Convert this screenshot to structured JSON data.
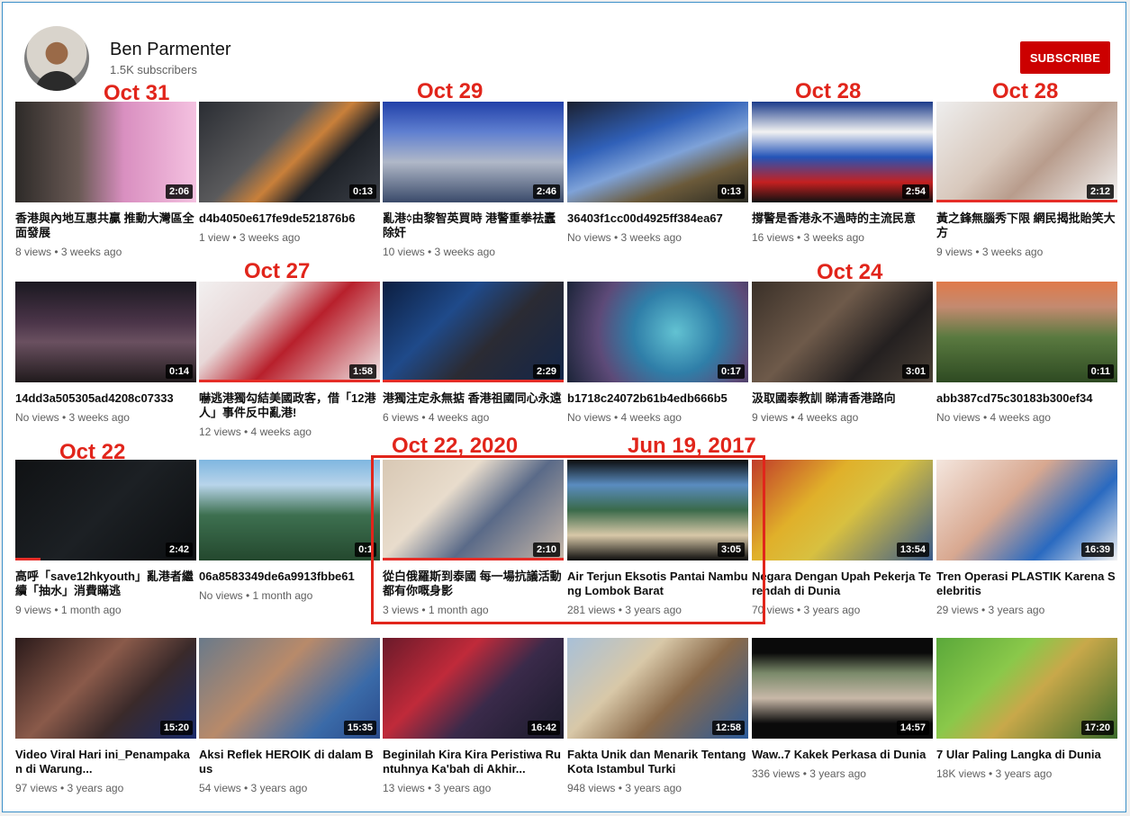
{
  "channel": {
    "name": "Ben Parmenter",
    "subscribers": "1.5K subscribers",
    "subscribe_label": "SUBSCRIBE"
  },
  "annotations": [
    "Oct 31",
    "Oct 29",
    "Oct 28",
    "Oct 28",
    "Oct 27",
    "Oct 24",
    "Oct 22",
    "Oct 22, 2020",
    "Jun 19, 2017"
  ],
  "videos": [
    {
      "title": "香港與內地互惠共贏 推動大灣區全面發展",
      "meta": "8 views • 3 weeks ago",
      "duration": "2:06",
      "art": "linear-gradient(90deg,#2d2a28 0%,#6a5a55 35%,#d98fc0 60%,#f4c1e0 100%)",
      "progress": 0
    },
    {
      "title": "d4b4050e617fe9de521876b6",
      "meta": "1 view • 3 weeks ago",
      "duration": "0:13",
      "art": "linear-gradient(135deg,#2a2d33 0%,#5a5a5c 40%,#c9803a 55%,#1e2228 70%,#3c4048 100%)",
      "progress": 0
    },
    {
      "title": "亂港᨟由黎智英買時 港警重拳祛蠹除奸",
      "meta": "10 views • 3 weeks ago",
      "duration": "2:46",
      "art": "linear-gradient(180deg,#2140a8 0%,#5f7fd0 30%,#b0b8c8 60%,#3a4a6a 100%)",
      "progress": 0
    },
    {
      "title": "36403f1cc00d4925ff384ea67",
      "meta": "No views • 3 weeks ago",
      "duration": "0:13",
      "art": "linear-gradient(160deg,#1b2030 0%,#3060b8 35%,#7ea2d8 55%,#6b5a3a 75%,#2a2a22 100%)",
      "progress": 0
    },
    {
      "title": "撐警是香港永不過時的主流民意",
      "meta": "16 views • 3 weeks ago",
      "duration": "2:54",
      "art": "linear-gradient(180deg,#1a3a8a 0%,#f2f2f2 30%,#2454b8 55%,#c42020 80%,#111 100%)",
      "progress": 0
    },
    {
      "title": "黃之鋒無腦秀下限 網民揭批貽笑大方",
      "meta": "9 views • 3 weeks ago",
      "duration": "2:12",
      "art": "linear-gradient(135deg,#eeeeee 0%,#d8c8bc 40%,#b89c8c 60%,#f3f3f3 100%)",
      "progress": 100
    },
    {
      "title": "14dd3a505305ad4208c07333",
      "meta": "No views • 3 weeks ago",
      "duration": "0:14",
      "art": "linear-gradient(180deg,#1a1820 0%,#4a3448 40%,#6a5060 60%,#201a1c 100%)",
      "progress": 0
    },
    {
      "title": "嚇逃港獨勾結美國政客，借「12港人」事件反中亂港!",
      "meta": "12 views • 4 weeks ago",
      "duration": "1:58",
      "art": "linear-gradient(135deg,#f2f0f0 0%,#e8d8d8 30%,#b8202c 55%,#f0eaea 100%)",
      "progress": 100
    },
    {
      "title": "港獨注定永無掂 香港祖國同心永遠",
      "meta": "6 views • 4 weeks ago",
      "duration": "2:29",
      "art": "linear-gradient(135deg,#0c1e40 0%,#1f4a8a 35%,#2b2b33 60%,#13264a 100%)",
      "progress": 100
    },
    {
      "title": "b1718c24072b61b4edb666b5",
      "meta": "No views • 4 weeks ago",
      "duration": "0:17",
      "art": "radial-gradient(circle at 60% 50%,#62c2d2 0%,#2f7ea8 35%,#5d4a78 65%,#1b2438 100%)",
      "progress": 0
    },
    {
      "title": "汲取國泰教訓 睇清香港路向",
      "meta": "9 views • 4 weeks ago",
      "duration": "3:01",
      "art": "linear-gradient(135deg,#3a3028 0%,#6e5a4a 40%,#242020 70%,#4a4036 100%)",
      "progress": 0
    },
    {
      "title": "abb387cd75c30183b300ef34",
      "meta": "No views • 4 weeks ago",
      "duration": "0:11",
      "art": "linear-gradient(180deg,#e07a4a 0%,#c48a70 25%,#5a7a40 55%,#2e4a22 100%)",
      "progress": 0
    },
    {
      "title": "高呼「save12hkyouth」亂港者繼續「抽水」消費瞞逃",
      "meta": "9 views • 1 month ago",
      "duration": "2:42",
      "art": "linear-gradient(135deg,#101214 0%,#1c2024 50%,#0c0e10 100%)",
      "progress": 14
    },
    {
      "title": "06a8583349de6a9913fbbe61",
      "meta": "No views • 1 month ago",
      "duration": "0:1",
      "art": "linear-gradient(180deg,#7fb6e0 0%,#b8d4ea 25%,#3d7050 55%,#24482e 100%)",
      "progress": 0
    },
    {
      "title": "從白俄羅斯到泰國 每一場抗議活動都有你嘅身影",
      "meta": "3 views • 1 month ago",
      "duration": "2:10",
      "art": "linear-gradient(135deg,#d8c8b4 0%,#e8dccc 35%,#5a6a88 60%,#c8b8a8 100%)",
      "progress": 100
    },
    {
      "title": "Air Terjun Eksotis Pantai Nambung Lombok Barat",
      "meta": "281 views • 3 years ago",
      "duration": "3:05",
      "art": "linear-gradient(180deg,#0c0c0c 0%,#5a8cc0 25%,#3a6a4a 50%,#d8c8a8 75%,#0c0c0c 100%)",
      "progress": 0
    },
    {
      "title": "Negara Dengan Upah Pekerja Terendah di Dunia",
      "meta": "70 views • 3 years ago",
      "duration": "13:54",
      "art": "linear-gradient(135deg,#c03a2a 0%,#e0b02a 35%,#d8c040 55%,#3a5a8a 100%)",
      "progress": 0
    },
    {
      "title": "Tren Operasi PLASTIK Karena Selebritis",
      "meta": "29 views • 3 years ago",
      "duration": "16:39",
      "art": "linear-gradient(135deg,#f4e6de 0%,#d8a890 40%,#2a6ac0 70%,#f2f2f2 100%)",
      "progress": 0
    },
    {
      "title": "Video Viral Hari ini_Penampakan di Warung...",
      "meta": "97 views • 3 years ago",
      "duration": "15:20",
      "art": "linear-gradient(135deg,#2a1a1a 0%,#8a5a4a 40%,#3a2a2a 65%,#1a2a6a 100%)",
      "progress": 0
    },
    {
      "title": "Aksi Reflek HEROIK di dalam Bus",
      "meta": "54 views • 3 years ago",
      "duration": "15:35",
      "art": "linear-gradient(135deg,#6a7a8a 0%,#b88a6a 40%,#3a6aa8 75%,#2a4a8a 100%)",
      "progress": 0
    },
    {
      "title": "Beginilah Kira Kira Peristiwa Runtuhnya Ka'bah di Akhir...",
      "meta": "13 views • 3 years ago",
      "duration": "16:42",
      "art": "linear-gradient(135deg,#6a1a2a 0%,#c02a3a 35%,#3a2a4a 60%,#1a1a2a 100%)",
      "progress": 0
    },
    {
      "title": "Fakta Unik dan Menarik Tentang Kota Istambul Turki",
      "meta": "948 views • 3 years ago",
      "duration": "12:58",
      "art": "linear-gradient(135deg,#a8c0d8 0%,#d8c8a8 35%,#8a6a4a 60%,#2a5a9a 100%)",
      "progress": 0
    },
    {
      "title": "Waw..7 Kakek Perkasa di Dunia",
      "meta": "336 views • 3 years ago",
      "duration": "14:57",
      "art": "linear-gradient(180deg,#0a0a0a 0%,#0a0a0a 15%,#7a8a6a 35%,#c8b8a8 60%,#0a0a0a 85%)",
      "progress": 0
    },
    {
      "title": "7 Ular Paling Langka di Dunia",
      "meta": "18K views • 3 years ago",
      "duration": "17:20",
      "art": "linear-gradient(135deg,#5aa83a 0%,#8ac84a 35%,#c8a84a 55%,#3a6a2a 100%)",
      "progress": 0
    }
  ]
}
